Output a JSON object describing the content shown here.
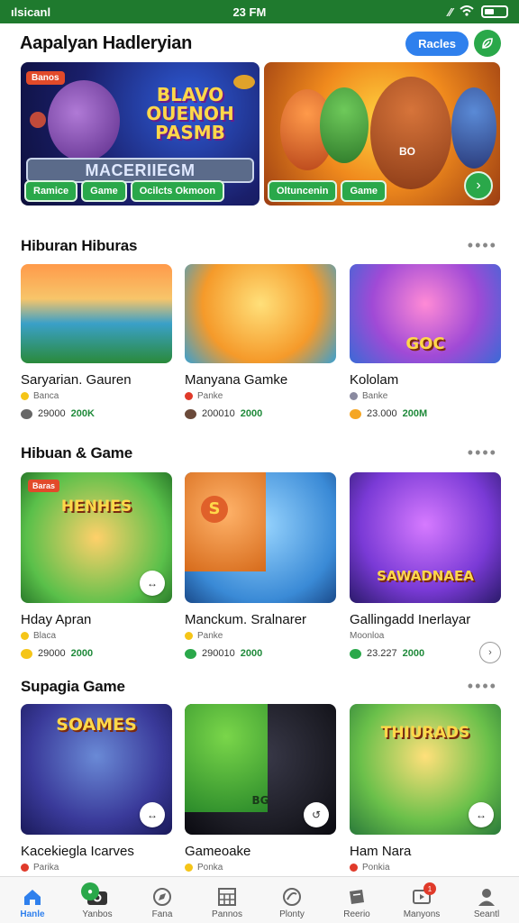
{
  "status_bar": {
    "left": "ılsicanl",
    "time": "23 FM"
  },
  "header": {
    "title": "Aapalyan Hadleryian",
    "pill_label": "Racles",
    "round_icon": "leaf-icon"
  },
  "banners": [
    {
      "tag": "Banos",
      "headline": "BLAVO\nOUENOH\nPASMB",
      "subtitle": "MACERIIEGM",
      "chips": [
        "Ramice",
        "Game",
        "Ocilcts Okmoon"
      ]
    },
    {
      "tag": "",
      "headline": "",
      "subtitle": "",
      "chips": [
        "Oltuncenin",
        "Game"
      ],
      "arrow": "›",
      "character_label": "BO"
    }
  ],
  "sections": [
    {
      "title": "Hiburan Hiburas",
      "more": "••••",
      "cards": [
        {
          "name": "Saryarian. Gauren",
          "meta": "Banca",
          "count": "29000",
          "highlight": "200K",
          "meta_color": "#f5c518",
          "coin_color": "#666"
        },
        {
          "name": "Manyana Gamke",
          "meta": "Panke",
          "count": "200010",
          "highlight": "2000",
          "meta_color": "#e03a2a",
          "coin_color": "#6b4a3a"
        },
        {
          "name": "Kololam",
          "meta": "Banke",
          "count": "23.000",
          "highlight": "200M",
          "meta_color": "#8a8aa0",
          "coin_color": "#f5a623",
          "thumb_text": "GOC"
        }
      ]
    },
    {
      "title": "Hibuan & Game",
      "more": "••••",
      "cards": [
        {
          "name": "Hday Apran",
          "meta": "Blaca",
          "count": "29000",
          "highlight": "2000",
          "meta_color": "#f5c518",
          "coin_color": "#f5c518",
          "thumb_tag": "Baras",
          "thumb_text": "HENHES",
          "corner": "↔"
        },
        {
          "name": "Manckum. Sralnarer",
          "meta": "Panke",
          "count": "290010",
          "highlight": "2000",
          "meta_color": "#f5c518",
          "coin_color": "#2aa84a",
          "thumb_text": "S"
        },
        {
          "name": "Gallingadd Inerlayar",
          "meta": "Moonloa",
          "count": "23.227",
          "highlight": "2000",
          "meta_color": "#8a8aa0",
          "coin_color": "#2aa84a",
          "thumb_text": "SAWADNAEA",
          "outline_btn": "›"
        }
      ]
    },
    {
      "title": "Supagia Game",
      "more": "••••",
      "cards": [
        {
          "name": "Kacekiegla Icarves",
          "meta": "Parika",
          "meta_color": "#e03a2a",
          "thumb_text": "SOAMES",
          "corner": "↔"
        },
        {
          "name": "Gameoake",
          "meta": "Ponka",
          "meta_color": "#f5c518",
          "thumb_text": "BG",
          "corner": "↺"
        },
        {
          "name": "Ham Nara",
          "meta": "Ponkia",
          "meta_color": "#e03a2a",
          "thumb_text": "THIURADS",
          "corner": "↔"
        }
      ]
    }
  ],
  "tabs": [
    {
      "label": "Hanle",
      "icon": "home-icon",
      "active": true
    },
    {
      "label": "Yanbos",
      "icon": "camera-icon",
      "badge": "●"
    },
    {
      "label": "Fana",
      "icon": "compass-icon"
    },
    {
      "label": "Pannos",
      "icon": "grid-icon"
    },
    {
      "label": "Plonty",
      "icon": "globe-icon"
    },
    {
      "label": "Reerio",
      "icon": "tag-icon"
    },
    {
      "label": "Manyons",
      "icon": "tv-icon",
      "badge": "1"
    },
    {
      "label": "Seantl",
      "icon": "profile-icon"
    }
  ]
}
